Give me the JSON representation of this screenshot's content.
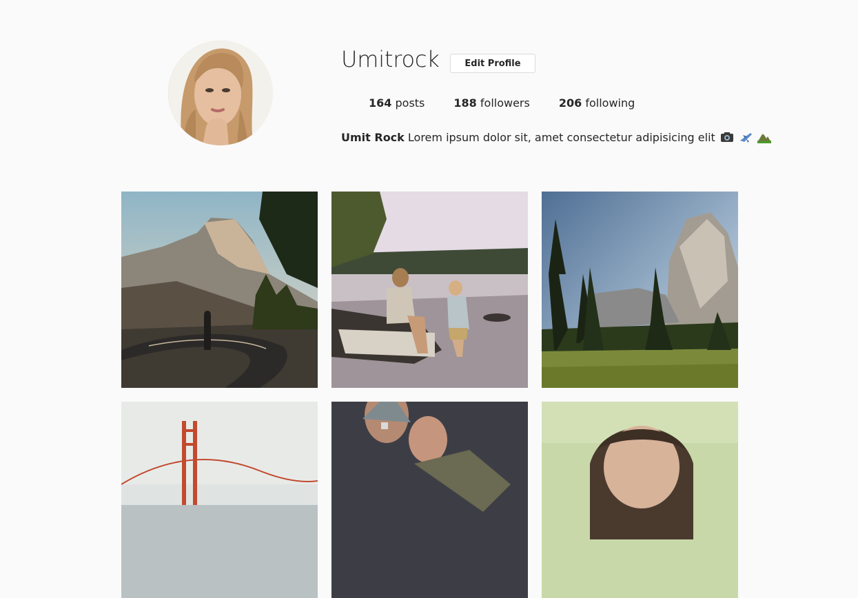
{
  "profile": {
    "username": "Umitrock",
    "edit_button": "Edit Profile",
    "stats": {
      "posts_count": "164",
      "posts_label": "posts",
      "followers_count": "188",
      "followers_label": "followers",
      "following_count": "206",
      "following_label": "following"
    },
    "bio": {
      "name": "Umit Rock",
      "text": "Lorem ipsum dolor sit, amet consectetur adipisicing elit",
      "emojis": [
        "camera-icon",
        "airplane-icon",
        "mountain-icon"
      ]
    }
  },
  "gallery": {
    "posts": [
      {
        "name": "half-dome-road-photo"
      },
      {
        "name": "lake-mother-child-photo"
      },
      {
        "name": "el-capitan-meadow-photo"
      },
      {
        "name": "golden-gate-bridge-photo"
      },
      {
        "name": "hands-phone-photo"
      },
      {
        "name": "woman-portrait-photo"
      }
    ]
  }
}
